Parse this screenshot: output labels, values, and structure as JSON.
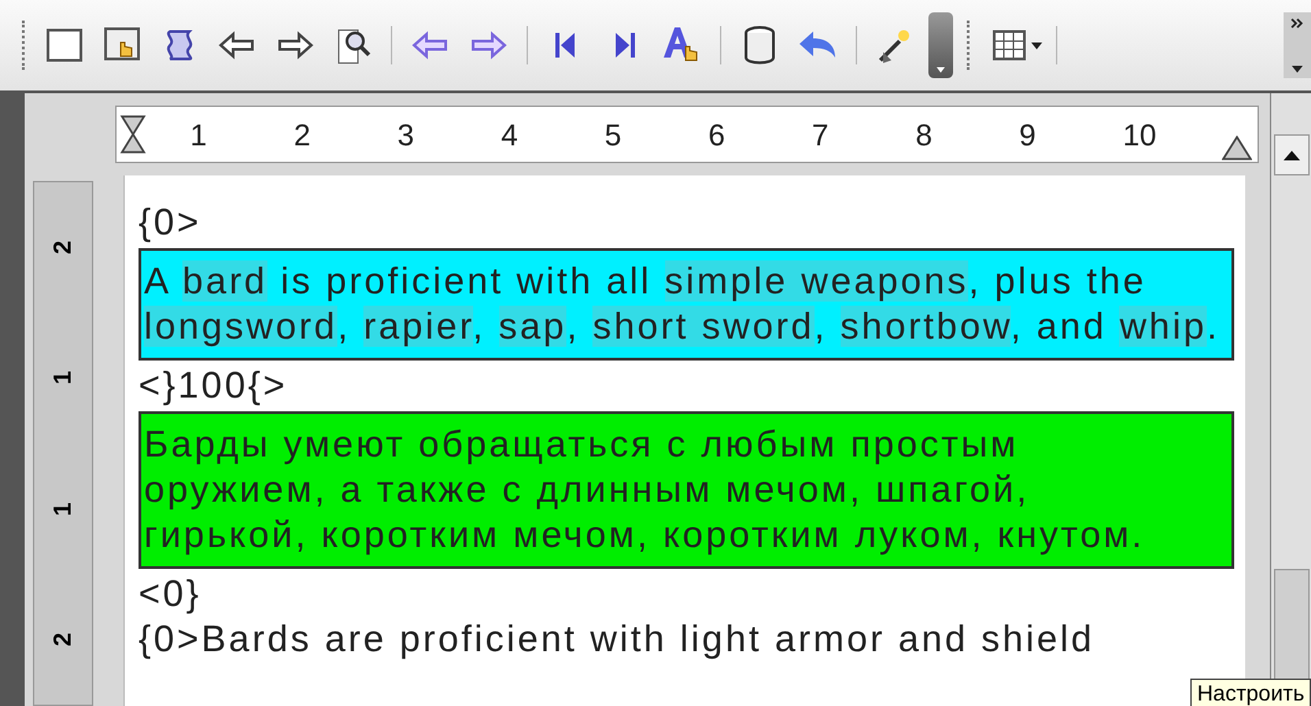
{
  "ruler": {
    "numbers": [
      "1",
      "2",
      "3",
      "4",
      "5",
      "6",
      "7",
      "8",
      "9",
      "10"
    ]
  },
  "vertical_ruler": {
    "numbers": [
      "2",
      "1",
      "1",
      "2"
    ]
  },
  "document": [
    {
      "kind": "tag",
      "text": "{0>"
    },
    {
      "kind": "source",
      "color": "#00f0ff",
      "lines": [
        [
          {
            "text": "A ",
            "highlight": false
          },
          {
            "text": "bard",
            "highlight": true
          },
          {
            "text": " is proficient with all ",
            "highlight": false
          },
          {
            "text": "simple weapons",
            "highlight": true
          },
          {
            "text": ", plus the",
            "highlight": false
          }
        ],
        [
          {
            "text": "longsword",
            "highlight": true
          },
          {
            "text": ", ",
            "highlight": false
          },
          {
            "text": "rapier",
            "highlight": true
          },
          {
            "text": ", ",
            "highlight": false
          },
          {
            "text": "sap",
            "highlight": true
          },
          {
            "text": ", ",
            "highlight": false
          },
          {
            "text": "short sword",
            "highlight": true
          },
          {
            "text": ", ",
            "highlight": false
          },
          {
            "text": "shortbow",
            "highlight": true
          },
          {
            "text": ", and ",
            "highlight": false
          },
          {
            "text": "whip",
            "highlight": true
          },
          {
            "text": ".",
            "highlight": false
          }
        ]
      ]
    },
    {
      "kind": "tag",
      "text": "<}100{>"
    },
    {
      "kind": "target",
      "color": "#00ee00",
      "lines": [
        [
          {
            "text": "Барды умеют обращаться с любым простым",
            "highlight": false
          }
        ],
        [
          {
            "text": "оружием, а также с длинным мечом, шпагой,",
            "highlight": false
          }
        ],
        [
          {
            "text": "гирькой, коротким мечом, коротким луком, кнутом.",
            "highlight": false
          }
        ]
      ]
    },
    {
      "kind": "tag",
      "text": "<0}"
    },
    {
      "kind": "tag",
      "text": "{0>Bards are proficient with light armor and shield"
    }
  ],
  "tooltip": {
    "text": "Настроить"
  }
}
